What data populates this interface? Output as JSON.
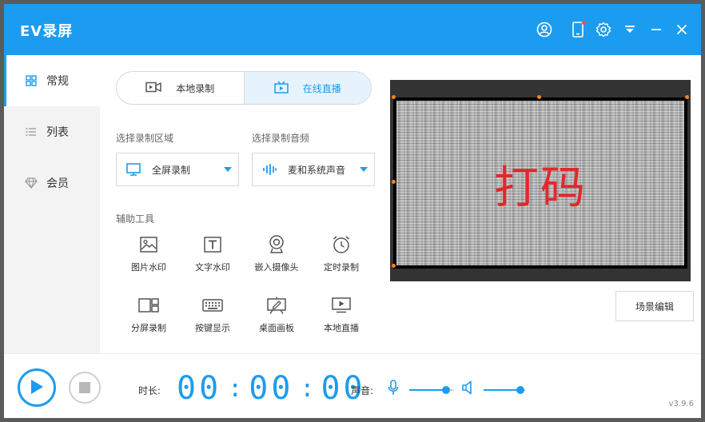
{
  "app": {
    "title": "EV录屏",
    "version": "v3.9.6"
  },
  "titlebar": {
    "icons": [
      "user-circle-icon",
      "phone-icon",
      "settings-gear-icon",
      "dropdown-menu-icon",
      "minimize-icon",
      "close-icon"
    ]
  },
  "sidebar": {
    "items": [
      {
        "label": "常规",
        "icon": "grid-icon",
        "active": true
      },
      {
        "label": "列表",
        "icon": "list-icon",
        "active": false
      },
      {
        "label": "会员",
        "icon": "diamond-icon",
        "active": false
      }
    ]
  },
  "mode_tabs": {
    "local": {
      "label": "本地录制",
      "icon": "video-camera-icon",
      "active": false
    },
    "live": {
      "label": "在线直播",
      "icon": "tv-broadcast-icon",
      "active": true
    }
  },
  "record_area": {
    "section_label": "选择录制区域",
    "value": "全屏录制",
    "icon": "monitor-icon"
  },
  "record_audio": {
    "section_label": "选择录制音频",
    "value": "麦和系统声音",
    "icon": "audio-wave-icon"
  },
  "tools": {
    "section_label": "辅助工具",
    "items": [
      {
        "label": "图片水印",
        "icon": "image-icon"
      },
      {
        "label": "文字水印",
        "icon": "text-t-icon"
      },
      {
        "label": "嵌入摄像头",
        "icon": "webcam-icon"
      },
      {
        "label": "定时录制",
        "icon": "alarm-clock-icon"
      },
      {
        "label": "分屏录制",
        "icon": "split-screen-icon"
      },
      {
        "label": "按键显示",
        "icon": "keyboard-icon"
      },
      {
        "label": "桌面画板",
        "icon": "drawing-board-icon"
      },
      {
        "label": "本地直播",
        "icon": "play-screen-icon"
      }
    ]
  },
  "preview": {
    "stamp_text": "打码"
  },
  "scene_edit_label": "场景编辑",
  "bottom": {
    "duration_label": "时长:",
    "timer": {
      "hours": "00",
      "minutes": "00",
      "seconds": "00"
    },
    "volume_label": "声音:",
    "mic_level": 0.82,
    "speaker_level": 0.88
  },
  "colors": {
    "accent": "#1c9cf0",
    "stamp": "#e0282e",
    "handle": "#f5821f"
  }
}
